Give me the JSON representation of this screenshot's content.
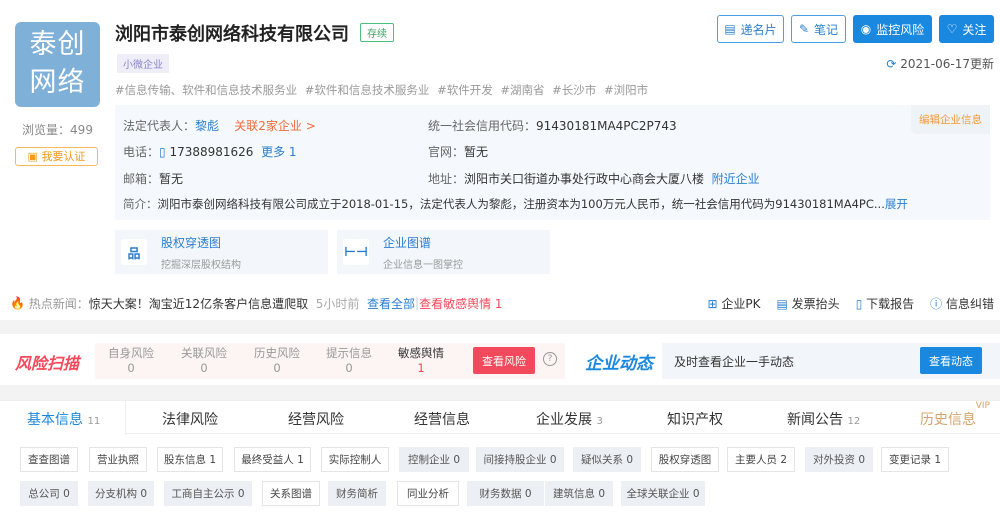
{
  "company": {
    "logo_text": [
      "泰创",
      "网络"
    ],
    "name": "浏阳市泰创网络科技有限公司",
    "status": "存续",
    "scale": "小微企业",
    "tags": "#信息传输、软件和信息技术服务业  #软件和信息技术服务业  #软件开发  #湖南省  #长沙市  #浏阳市",
    "views": "浏览量：499",
    "certify": "我要认证",
    "updated": "2021-06-17更新"
  },
  "actions": {
    "card": "递名片",
    "note": "笔记",
    "monitor": "监控风险",
    "follow": "关注"
  },
  "info": {
    "edit": "编辑企业信息",
    "legal_label": "法定代表人：",
    "legal": "黎彪",
    "related": "关联2家企业 >",
    "credit_label": "统一社会信用代码：",
    "credit": "91430181MA4PC2P743",
    "phone_label": "电话：",
    "phone": "17388981626",
    "phone_more": "更多 1",
    "site_label": "官网：",
    "site": "暂无",
    "email_label": "邮箱：",
    "email": "暂无",
    "addr_label": "地址：",
    "addr": "浏阳市关口街道办事处行政中心商会大厦八楼",
    "nearby": "附近企业",
    "intro_label": "简介：",
    "intro": "浏阳市泰创网络科技有限公司成立于2018-01-15，法定代表人为黎彪，注册资本为100万元人民币，统一社会信用代码为91430181MA4PC...",
    "expand": "展开"
  },
  "cards": [
    {
      "title": "股权穿透图",
      "sub": "挖掘深层股权结构"
    },
    {
      "title": "企业图谱",
      "sub": "企业信息一图掌控"
    }
  ],
  "news": {
    "label": "热点新闻：",
    "headline": "惊天大案！淘宝近12亿条客户信息遭爬取",
    "time": "5小时前",
    "all": "查看全部",
    "sensitive": "查看敏感舆情 1",
    "tools": [
      "企业PK",
      "发票抬头",
      "下载报告",
      "信息纠错"
    ]
  },
  "risk": {
    "title": "风险扫描",
    "items": [
      {
        "label": "自身风险",
        "value": "0"
      },
      {
        "label": "关联风险",
        "value": "0"
      },
      {
        "label": "历史风险",
        "value": "0"
      },
      {
        "label": "提示信息",
        "value": "0"
      },
      {
        "label": "敏感舆情",
        "value": "1"
      }
    ],
    "button": "查看风险"
  },
  "dynamic": {
    "title": "企业动态",
    "text": "及时查看企业一手动态",
    "button": "查看动态"
  },
  "tabs": [
    {
      "label": "基本信息",
      "count": "11"
    },
    {
      "label": "法律风险"
    },
    {
      "label": "经营风险"
    },
    {
      "label": "经营信息"
    },
    {
      "label": "企业发展",
      "count": "3"
    },
    {
      "label": "知识产权"
    },
    {
      "label": "新闻公告",
      "count": "12"
    },
    {
      "label": "历史信息",
      "badge": "VIP"
    }
  ],
  "chips": [
    {
      "label": "查查图谱",
      "disabled": false
    },
    {
      "label": "营业执照",
      "disabled": false
    },
    {
      "label": "股东信息 1",
      "disabled": false
    },
    {
      "label": "最终受益人 1",
      "disabled": false
    },
    {
      "label": "实际控制人",
      "disabled": false
    },
    {
      "label": "控制企业 0",
      "disabled": true
    },
    {
      "label": "间接持股企业 0",
      "disabled": true
    },
    {
      "label": "疑似关系 0",
      "disabled": true
    },
    {
      "label": "股权穿透图",
      "disabled": false
    },
    {
      "label": "主要人员 2",
      "disabled": false
    },
    {
      "label": "对外投资 0",
      "disabled": true
    },
    {
      "label": "变更记录 1",
      "disabled": false
    },
    {
      "label": "总公司 0",
      "disabled": true
    },
    {
      "label": "分支机构 0",
      "disabled": true
    },
    {
      "label": "工商自主公示 0",
      "disabled": true
    },
    {
      "label": "关系图谱",
      "disabled": false
    },
    {
      "label": "财务简析",
      "disabled": true
    },
    {
      "label": "同业分析",
      "disabled": false
    },
    {
      "label": "财务数据 0",
      "disabled": true
    },
    {
      "label": "建筑信息 0",
      "disabled": true
    },
    {
      "label": "全球关联企业 0",
      "disabled": true
    }
  ]
}
